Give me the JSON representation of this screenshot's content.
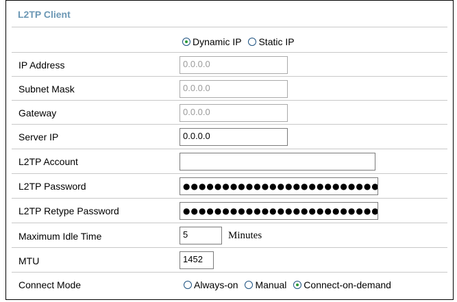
{
  "section": {
    "title": "L2TP Client"
  },
  "ip_mode": {
    "options": [
      "Dynamic IP",
      "Static IP"
    ],
    "selected": "Dynamic IP"
  },
  "fields": {
    "ip_address": {
      "label": "IP Address",
      "value": "0.0.0.0"
    },
    "subnet_mask": {
      "label": "Subnet Mask",
      "value": "0.0.0.0"
    },
    "gateway": {
      "label": "Gateway",
      "value": "0.0.0.0"
    },
    "server_ip": {
      "label": "Server IP",
      "value": "0.0.0.0"
    },
    "account": {
      "label": "L2TP Account",
      "value": ""
    },
    "password": {
      "label": "L2TP Password",
      "value": "●●●●●●●●●●●●●●●●●●●●●●●●●●●●●●●●"
    },
    "retype_password": {
      "label": "L2TP Retype Password",
      "value": "●●●●●●●●●●●●●●●●●●●●●●●●●●●●●●●●"
    },
    "idle_time": {
      "label": "Maximum Idle Time",
      "value": "5",
      "unit": "Minutes"
    },
    "mtu": {
      "label": "MTU",
      "value": "1452"
    }
  },
  "connect_mode": {
    "label": "Connect Mode",
    "options": [
      "Always-on",
      "Manual",
      "Connect-on-demand"
    ],
    "selected": "Connect-on-demand"
  }
}
